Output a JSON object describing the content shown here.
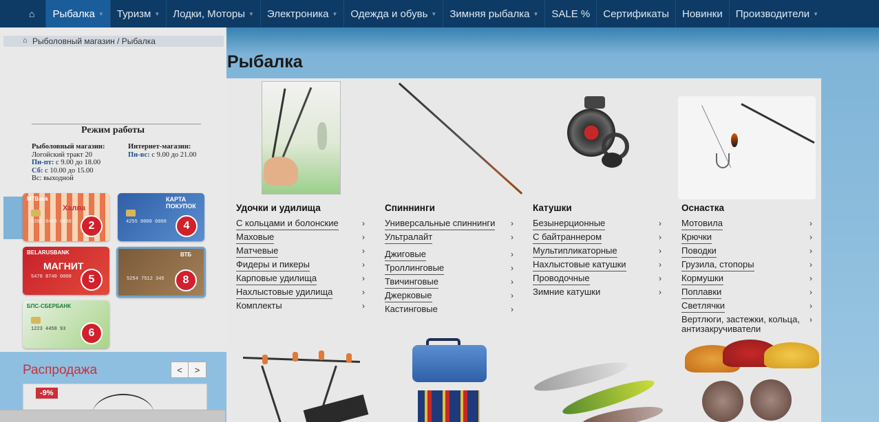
{
  "nav": {
    "items": [
      {
        "label": "Рыбалка",
        "caret": true,
        "active": true
      },
      {
        "label": "Туризм",
        "caret": true
      },
      {
        "label": "Лодки, Моторы",
        "caret": true
      },
      {
        "label": "Электроника",
        "caret": true
      },
      {
        "label": "Одежда и обувь",
        "caret": true
      },
      {
        "label": "Зимняя рыбалка",
        "caret": true
      },
      {
        "label": "SALE %",
        "caret": false
      },
      {
        "label": "Сертификаты",
        "caret": false
      },
      {
        "label": "Новинки",
        "caret": false
      },
      {
        "label": "Производители",
        "caret": true
      }
    ]
  },
  "breadcrumb": {
    "text": "Рыболовный магазин /  Рыбалка"
  },
  "hours": {
    "title": "Режим работы",
    "store_label": "Рыболовный магазин:",
    "store_address": "Логойский тракт 20",
    "store_weekdays_label": "Пн-пт:",
    "store_weekdays": " с 9.00 до 18.00",
    "store_sat_label": "Сб:",
    "store_sat": " с 10.00 до 15.00",
    "store_sun": "Вс: выходной",
    "online_label": "Интернет-магазин:",
    "online_days_label": "Пн-вс:",
    "online_hours": " с 9.00 до 21.00"
  },
  "cards": [
    {
      "bank": "MTBank",
      "brand": "Халва",
      "number": "5395 0400 0000",
      "months": "2"
    },
    {
      "bank": "",
      "brand": "КАРТА ПОКУПОК",
      "number": "4255 0000 0000",
      "months": "4"
    },
    {
      "bank": "BELARUSBANK",
      "brand": "МАГНИТ",
      "number": "5470 8740 0000",
      "months": "5"
    },
    {
      "bank": "ВТБ",
      "brand": "",
      "number": "5254 7512 345",
      "months": "8"
    },
    {
      "bank": "БПС-СБЕРБАНК",
      "brand": "",
      "number": "1223 4458 93",
      "months": "6"
    }
  ],
  "sale": {
    "title": "Распродажа",
    "prev": "<",
    "next": ">",
    "discount": "-9%"
  },
  "page_title": "Рыбалка",
  "categories": [
    {
      "title": "Удочки и удилища",
      "items": [
        {
          "label": "С кольцами и болонские",
          "u": true
        },
        {
          "label": "Маховые",
          "u": true
        },
        {
          "label": "Матчевые",
          "u": true
        },
        {
          "label": "Фидеры и пикеры",
          "u": true
        },
        {
          "label": "Карповые удилища",
          "u": true
        },
        {
          "label": "Нахлыстовые удилища",
          "u": true
        },
        {
          "label": "Комплекты",
          "u": false
        }
      ]
    },
    {
      "title": "Спиннинги",
      "items": [
        {
          "label": "Универсальные спиннинги",
          "u": true
        },
        {
          "label": "Ультралайт",
          "u": true
        },
        {
          "label": "Джиговые",
          "u": true
        },
        {
          "label": "Троллинговые",
          "u": true
        },
        {
          "label": "Твичинговые",
          "u": true
        },
        {
          "label": "Джерковые",
          "u": true
        },
        {
          "label": "Кастинговые",
          "u": false
        }
      ]
    },
    {
      "title": "Катушки",
      "items": [
        {
          "label": "Безынерционные",
          "u": true
        },
        {
          "label": "С байтраннером",
          "u": true
        },
        {
          "label": "Мультипликаторные",
          "u": true
        },
        {
          "label": "Нахлыстовые катушки",
          "u": true
        },
        {
          "label": "Проводочные",
          "u": true
        },
        {
          "label": "Зимние катушки",
          "u": false
        }
      ]
    },
    {
      "title": "Оснастка",
      "items": [
        {
          "label": "Мотовила",
          "u": true
        },
        {
          "label": "Крючки",
          "u": true
        },
        {
          "label": "Поводки",
          "u": true
        },
        {
          "label": "Грузила, стопоры",
          "u": true
        },
        {
          "label": "Кормушки",
          "u": true
        },
        {
          "label": "Поплавки",
          "u": true
        },
        {
          "label": "Светлячки",
          "u": true
        },
        {
          "label": "Вертлюги, застежки, кольца, антизакручиватели",
          "u": false
        }
      ]
    }
  ]
}
